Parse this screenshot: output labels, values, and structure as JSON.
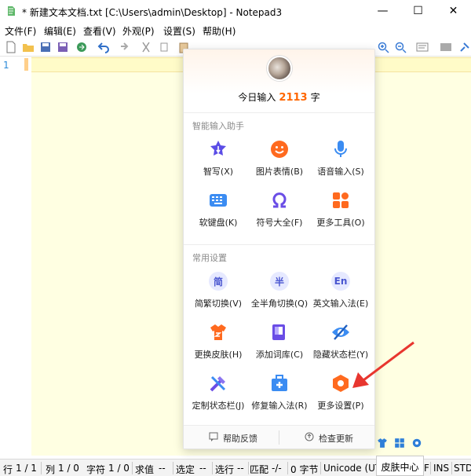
{
  "titlebar": {
    "title": "* 新建文本文档.txt [C:\\Users\\admin\\Desktop] - Notepad3",
    "minimize": "—",
    "maximize": "☐",
    "close": "✕"
  },
  "menu": [
    "文件(F)",
    "编辑(E)",
    "查看(V)",
    "外观(P)",
    "设置(S)",
    "帮助(H)"
  ],
  "editor": {
    "line_number": "1"
  },
  "panel": {
    "today_prefix": "今日输入",
    "today_count": "2113",
    "today_suffix": "字",
    "section1": "智能输入助手",
    "section2": "常用设置",
    "items": [
      {
        "label": "智写(X)",
        "icon": "pen-star-icon"
      },
      {
        "label": "图片表情(B)",
        "icon": "smiley-icon"
      },
      {
        "label": "语音输入(S)",
        "icon": "microphone-icon"
      },
      {
        "label": "软键盘(K)",
        "icon": "keyboard-icon"
      },
      {
        "label": "符号大全(F)",
        "icon": "omega-icon"
      },
      {
        "label": "更多工具(O)",
        "icon": "grid-tools-icon"
      },
      {
        "label": "简繁切换(V)",
        "icon": "jian-icon",
        "glyph": "简"
      },
      {
        "label": "全半角切换(Q)",
        "icon": "ban-icon",
        "glyph": "半"
      },
      {
        "label": "英文输入法(E)",
        "icon": "en-icon",
        "glyph": "En"
      },
      {
        "label": "更换皮肤(H)",
        "icon": "shirt-icon"
      },
      {
        "label": "添加词库(C)",
        "icon": "book-icon"
      },
      {
        "label": "隐藏状态栏(Y)",
        "icon": "eye-hidden-icon"
      },
      {
        "label": "定制状态栏(J)",
        "icon": "tools-icon"
      },
      {
        "label": "修复输入法(R)",
        "icon": "medkit-icon"
      },
      {
        "label": "更多设置(P)",
        "icon": "hexagon-settings-icon"
      }
    ],
    "feedback": "帮助反馈",
    "update": "检查更新"
  },
  "tooltip": "皮肤中心",
  "statusbar": {
    "row_label": "行",
    "row_val": "1 / 1",
    "col_label": "列",
    "col_val": "1 / 0",
    "char_label": "字符",
    "char_val": "1 / 0",
    "sum_label": "求值",
    "sum_val": "--",
    "sel_label": "选定",
    "sel_val": "--",
    "selrow_label": "选行",
    "selrow_val": "--",
    "match_label": "匹配",
    "match_val": "-/-",
    "bytes": "0 字节",
    "encoding": "Unicode (UT",
    "f": "F",
    "ins": "INS",
    "std": "STD"
  },
  "colors": {
    "accent": "#ff6600",
    "editor_bg": "#ffffe2",
    "icon_blue": "#4a56d0",
    "arrow": "#e8362f"
  }
}
